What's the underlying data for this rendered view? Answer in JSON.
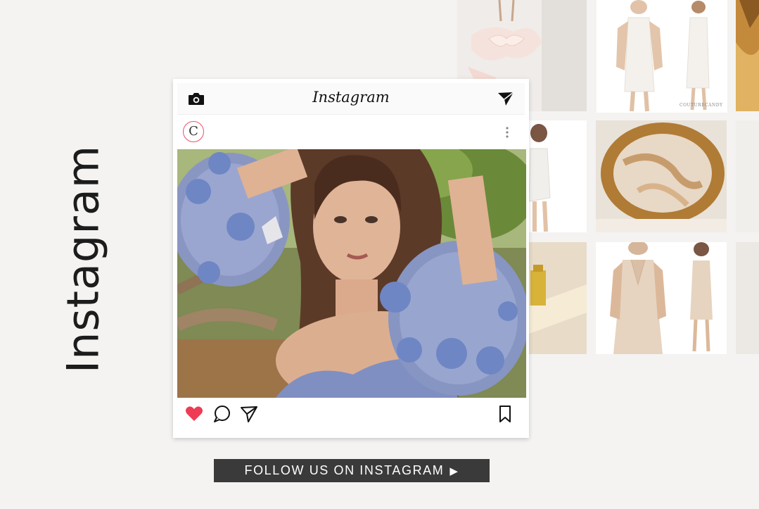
{
  "section": {
    "title": "Instagram"
  },
  "card": {
    "app_name": "Instagram",
    "avatar_letter": "C",
    "liked": true,
    "like_color": "#ee3c54"
  },
  "grid": {
    "watermark": "COUTURECANDY"
  },
  "cta": {
    "label": "FOLLOW US ON INSTAGRAM",
    "arrow": "▶"
  },
  "colors": {
    "background": "#f4f3f2",
    "button_bg": "#3a3a3a",
    "button_text": "#ffffff",
    "accent": "#ee3c54"
  }
}
